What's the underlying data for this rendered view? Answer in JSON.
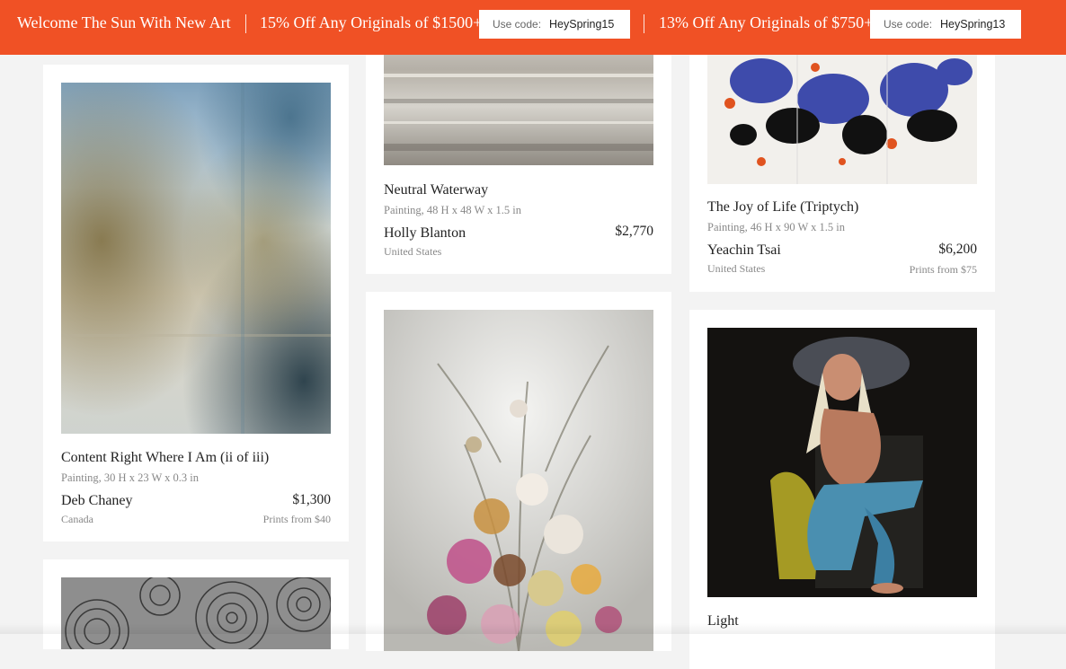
{
  "banner": {
    "welcome": "Welcome The Sun With New Art",
    "promo1_text": "15% Off Any Originals of $1500+",
    "promo1_code_label": "Use code:",
    "promo1_code": "HeySpring15",
    "promo2_text": "13% Off Any Originals of $750+",
    "promo2_code_label": "Use code:",
    "promo2_code": "HeySpring13",
    "color": "#f05125"
  },
  "artworks": [
    {
      "title": "Content Right Where I Am (ii of iii)",
      "meta": "Painting, 30 H x 23 W x 0.3 in",
      "artist": "Deb Chaney",
      "country": "Canada",
      "price": "$1,300",
      "prints": "Prints from $40"
    },
    {
      "title": "Neutral Waterway",
      "meta": "Painting, 48 H x 48 W x 1.5 in",
      "artist": "Holly Blanton",
      "country": "United States",
      "price": "$2,770"
    },
    {
      "title": "The Joy of Life (Triptych)",
      "meta": "Painting, 46 H x 90 W x 1.5 in",
      "artist": "Yeachin Tsai",
      "country": "United States",
      "price": "$6,200",
      "prints": "Prints from $75"
    },
    {
      "title": "Light"
    }
  ]
}
